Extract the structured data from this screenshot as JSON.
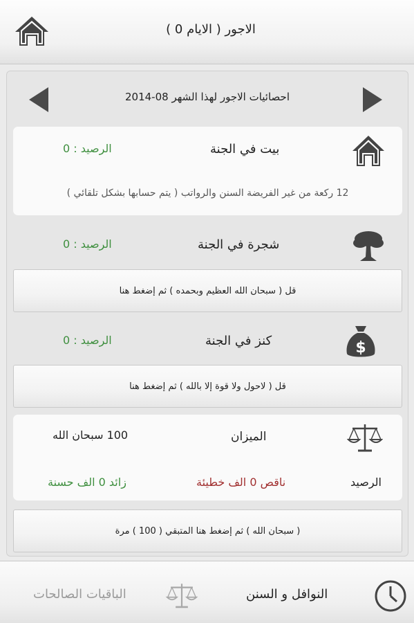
{
  "header": {
    "title": "الاجور ( الايام 0 )",
    "home_icon": "home-icon"
  },
  "month_nav": {
    "label": "احصائيات الاجور لهذا الشهر 08-2014",
    "prev_icon": "arrow-left-icon",
    "next_icon": "arrow-right-icon"
  },
  "house": {
    "title": "بيت في الجنة",
    "balance": "الرصيد : 0",
    "description": "12 ركعة من غير الفريضة السنن والرواتب ( يتم حسابها بشكل تلقائي )",
    "icon": "house-icon"
  },
  "tree": {
    "title": "شجرة  في الجنة",
    "balance": "الرصيد : 0",
    "button": "قل ( سبحان الله العظيم وبحمده ) ثم إضغط هنا",
    "icon": "tree-icon"
  },
  "treasure": {
    "title": "كنز في الجنة",
    "balance": "الرصيد : 0",
    "button": "قل ( لاحول ولا قوة إلا بالله ) ثم إضغط هنا",
    "icon": "money-bag-icon"
  },
  "scale": {
    "title": "الميزان",
    "count": "100 سبحان الله",
    "balance_label": "الرصيد",
    "minus": "ناقص 0 الف خطيئة",
    "plus": "زائد 0 الف حسنة",
    "button": "( سبحان الله ) ثم إضغط هنا المتبقي ( 100 ) مرة",
    "icon": "scale-icon"
  },
  "tabs": {
    "clock_icon": "clock-icon",
    "sunnah": "النوافل و السنن",
    "scale_icon": "scale-icon",
    "baqiyat": "الباقيات الصالحات"
  },
  "colors": {
    "balance_green": "#3f8f3f",
    "minus_red": "#a13030",
    "arrow": "#4a4a4a"
  }
}
